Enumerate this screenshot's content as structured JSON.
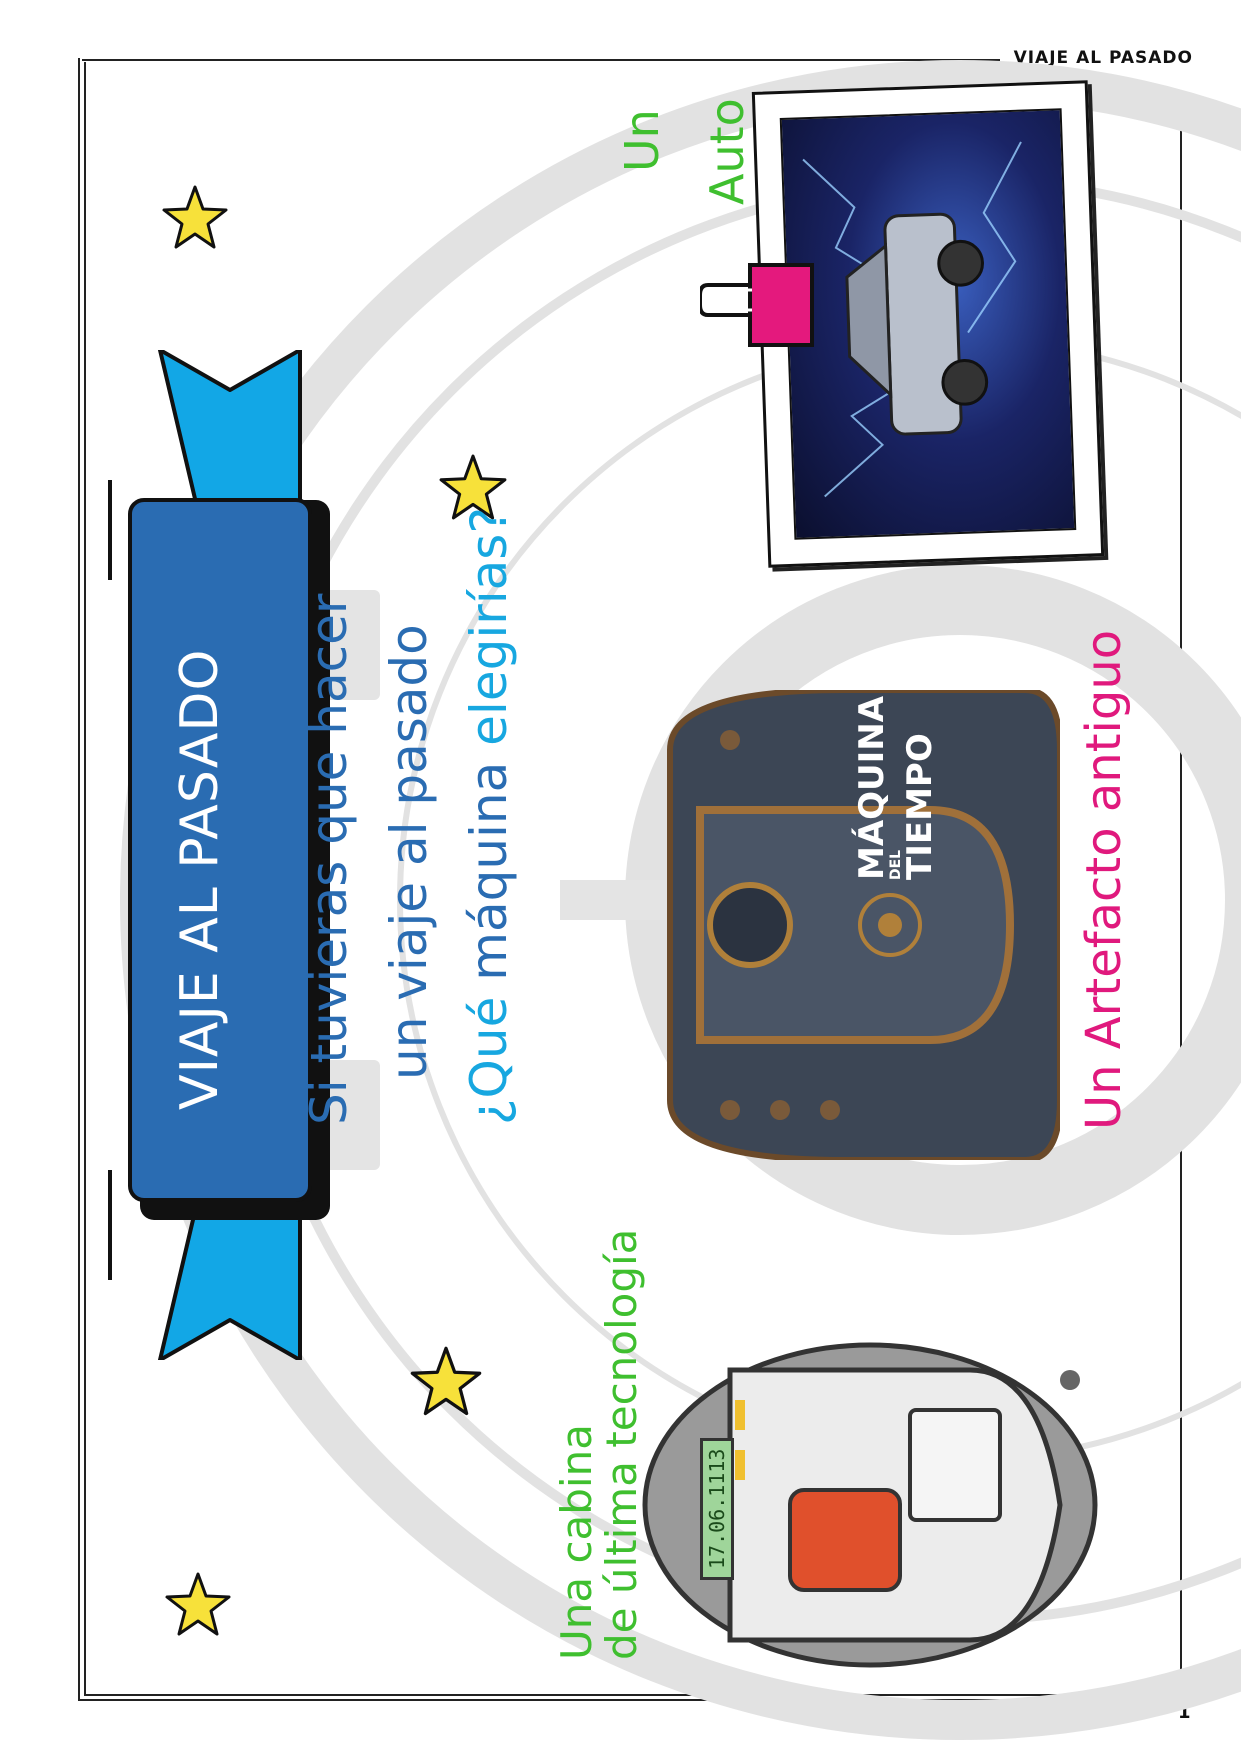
{
  "header": {
    "title": "VIAJE AL PASADO"
  },
  "page_number": "1",
  "banner": {
    "title": "VIAJE AL PASADO",
    "color": "#2a6cb2",
    "ribbon_color": "#12a7e6"
  },
  "question": {
    "line1": "Si tuvieras que hacer",
    "line2": "un viaje al pasado",
    "line3_a": "¿Qué",
    "line3_b": "máquina",
    "line3_c": "elegirías?",
    "color_main": "#2a6cb2",
    "color_accent": "#17a7e0"
  },
  "options": {
    "auto": {
      "line1": "Un",
      "line2": "Auto",
      "color": "#3fbf2f"
    },
    "artefacto": {
      "line1": "Un Artefacto antiguo",
      "color": "#e0197d"
    },
    "cabina": {
      "line1": "Una cabina",
      "line2": "de última tecnología",
      "color": "#3fbf2f"
    }
  },
  "artifact_label": {
    "line1": "MÁQUINA",
    "line2": "DEL",
    "line3": "TIEMPO"
  },
  "cabina_display": "17.06.1113",
  "icons": [
    "star-icon",
    "binder-clip-icon"
  ]
}
